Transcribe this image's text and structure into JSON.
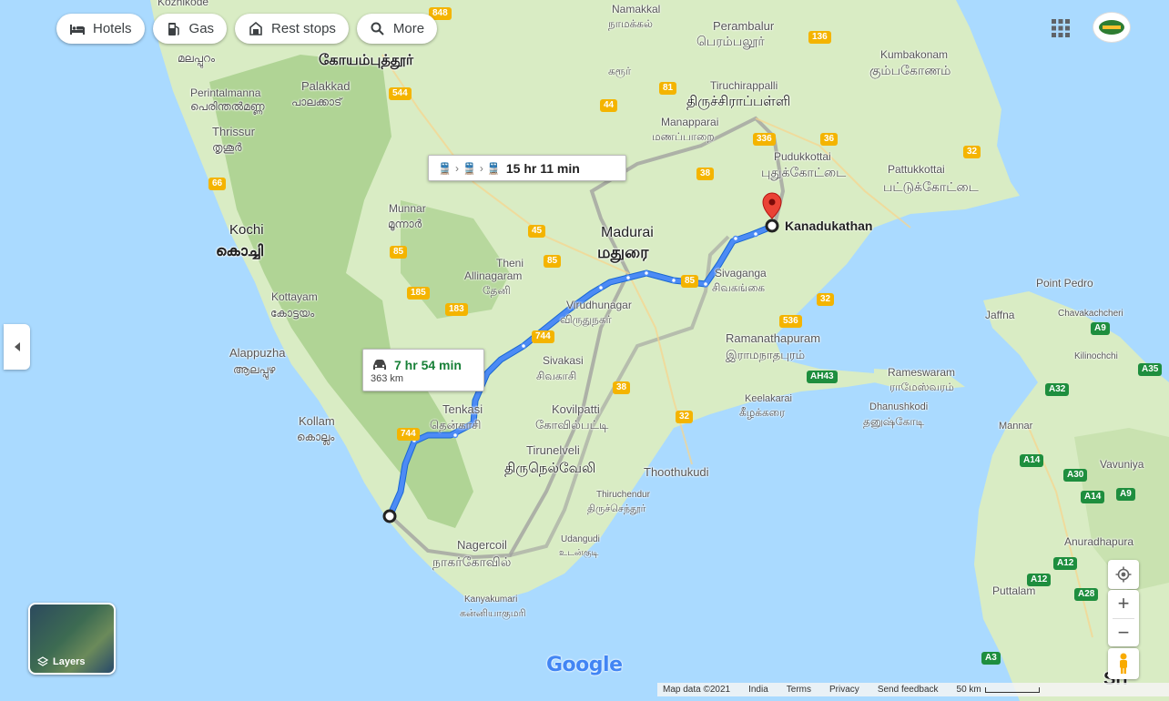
{
  "toolbar": {
    "chips": [
      {
        "label": "Hotels",
        "icon": "bed-icon"
      },
      {
        "label": "Gas",
        "icon": "gas-pump-icon"
      },
      {
        "label": "Rest stops",
        "icon": "rest-stop-icon"
      },
      {
        "label": "More",
        "icon": "search-icon"
      }
    ]
  },
  "route": {
    "transit": {
      "duration": "15 hr 11 min"
    },
    "drive": {
      "duration": "7 hr 54 min",
      "distance": "363 km"
    },
    "destination": "Kanadukathan",
    "route_color": "#4285f4",
    "alt_route_color": "#9e9e9e"
  },
  "places": {
    "kozhikode": "Kozhikode",
    "namakkal": "Namakkal",
    "namakkal_ta": "நாமக்கல்",
    "perambalur": "Perambalur",
    "perambalur_ta": "பெரம்பலூர்",
    "kumbakonam": "Kumbakonam",
    "kumbakonam_ta": "கும்பகோணம்",
    "coimbatore_ta": "கோயம்புத்தூர்",
    "karur_ta": "கரூர்",
    "malappuram_ml": "മലപ്പുറം",
    "palakkad": "Palakkad",
    "palakkad_ml": "പാലക്കാട്",
    "perintalmanna": "Perintalmanna",
    "perintalmanna_ml": "പെരിന്തൽമണ്ണ",
    "tiruchirappalli": "Tiruchirappalli",
    "tiruchirappalli_ta": "திருச்சிராப்பள்ளி",
    "thrissur": "Thrissur",
    "thrissur_ml": "തൃശൂർ",
    "manapparai": "Manapparai",
    "manapparai_ta": "மணப்பாறை",
    "pudukkottai": "Pudukkottai",
    "pudukkottai_ta": "புதுக்கோட்டை",
    "pattukkottai": "Pattukkottai",
    "pattukkottai_ta": "பட்டுக்கோட்டை",
    "munnar": "Munnar",
    "munnar_ml": "മൂന്നാർ",
    "kochi": "Kochi",
    "kochi_ml": "കൊച്ചി",
    "madurai": "Madurai",
    "madurai_ta": "மதுரை",
    "theni": "Theni",
    "theni_ta": "தேனி",
    "allinagaram": "Allinagaram",
    "sivaganga": "Sivaganga",
    "sivaganga_ta": "சிவகங்கை",
    "kottayam": "Kottayam",
    "kottayam_ml": "കോട്ടയം",
    "virudhunagar": "Virudhunagar",
    "virudhunagar_ta": "விருதுநகர்",
    "point_pedro": "Point Pedro",
    "jaffna": "Jaffna",
    "chavakachcheri": "Chavakachcheri",
    "kilinochchi": "Kilinochchi",
    "alappuzha": "Alappuzha",
    "alappuzha_ml": "ആലപ്പുഴ",
    "ramanathapuram": "Ramanathapuram",
    "ramanathapuram_ta": "இராமநாதபுரம்",
    "sivakasi": "Sivakasi",
    "sivakasi_ta": "சிவகாசி",
    "rameswaram": "Rameswaram",
    "rameswaram_ta": "ராமேஸ்வரம்",
    "dhanushkodi": "Dhanushkodi",
    "dhanushkodi_ta": "தனுஷ்கோடி",
    "keelakarai": "Keelakarai",
    "keelakarai_ta": "கீழக்கரை",
    "tenkasi": "Tenkasi",
    "tenkasi_ta": "தென்காசி",
    "kovilpatti": "Kovilpatti",
    "kovilpatti_ta": "கோவில்பட்டி",
    "kollam": "Kollam",
    "kollam_ml": "കൊല്ലം",
    "mannar": "Mannar",
    "vavuniya": "Vavuniya",
    "tirunelveli": "Tirunelveli",
    "tirunelveli_ta": "திருநெல்வேலி",
    "thoothukudi": "Thoothukudi",
    "thiruchendur": "Thiruchendur",
    "thiruchendur_ta": "திருச்செந்தூர்",
    "anuradhapura": "Anuradhapura",
    "udangudi": "Udangudi",
    "udangudi_ta": "உடன்குடி",
    "nagercoil": "Nagercoil",
    "nagercoil_ta": "நாகர்கோவில்",
    "kanyakumari": "Kanyakumari",
    "kanyakumari_ta": "கன்னியாகுமரி",
    "puttalam": "Puttalam",
    "sri_partial": "Sri"
  },
  "shields": {
    "r136": "136",
    "r81": "81",
    "r544": "544",
    "r44": "44",
    "r336": "336",
    "r36": "36",
    "r32a": "32",
    "r66": "66",
    "r38a": "38",
    "r45": "45",
    "r85a": "85",
    "r85b": "85",
    "r85c": "85",
    "r185": "185",
    "r183": "183",
    "r32b": "32",
    "r536": "536",
    "r744a": "744",
    "r744b": "744",
    "r38b": "38",
    "r32c": "32",
    "ah43": "AH43",
    "a9a": "A9",
    "a35": "A35",
    "a32": "A32",
    "a14a": "A14",
    "a30": "A30",
    "a14b": "A14",
    "a9b": "A9",
    "a12a": "A12",
    "a12b": "A12",
    "a28": "A28",
    "a3": "A3",
    "r848": "848"
  },
  "controls": {
    "layers_label": "Layers",
    "zoom_in": "+",
    "zoom_out": "−",
    "logo": "Google"
  },
  "footer": {
    "map_data": "Map data ©2021",
    "region": "India",
    "terms": "Terms",
    "privacy": "Privacy",
    "feedback": "Send feedback",
    "scale": "50 km"
  }
}
